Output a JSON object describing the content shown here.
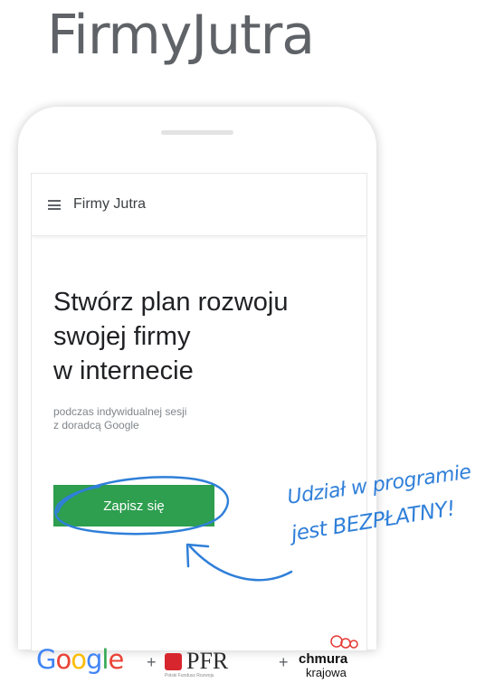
{
  "brand": {
    "title": "FirmyJutra"
  },
  "app_bar": {
    "menu_icon": "hamburger-menu-icon",
    "title": "Firmy Jutra"
  },
  "hero": {
    "headline_lines": [
      "Stwórz plan rozwoju",
      "swojej firmy",
      "w internecie"
    ],
    "subtext_lines": [
      "podczas indywidualnej sesji",
      "z doradcą Google"
    ],
    "cta_label": "Zapisz się"
  },
  "annotation": {
    "line1": "Udział w programie",
    "line2": "jest BEZPŁATNY!",
    "color": "#2f7fd9"
  },
  "partners": {
    "google": "Google",
    "plus_1": "+",
    "pfr": "PFR",
    "pfr_subtitle": "Polski Fundusz Rozwoju",
    "plus_2": "+",
    "chmura": "chmura",
    "krajowa": "krajowa"
  },
  "colors": {
    "cta_green": "#2e9e4f",
    "google_blue": "#4285f4",
    "google_red": "#ea4335",
    "google_yellow": "#fbbc05",
    "google_green": "#34a853",
    "pfr_red": "#d7262e",
    "chmura_red": "#e53935"
  }
}
